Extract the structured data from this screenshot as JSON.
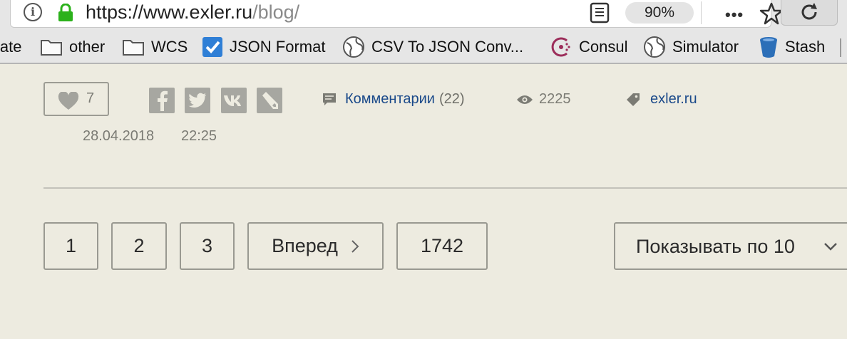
{
  "browser": {
    "url_host": "https://www.exler.ru",
    "url_path": "/blog/",
    "zoom": "90%",
    "bookmarks": [
      {
        "label": "late",
        "icon": "none"
      },
      {
        "label": "other",
        "icon": "folder-icon"
      },
      {
        "label": "WCS",
        "icon": "folder-icon"
      },
      {
        "label": "JSON Format",
        "icon": "checkbox-icon"
      },
      {
        "label": "CSV To JSON Conv...",
        "icon": "globe-icon"
      },
      {
        "label": "Consul",
        "icon": "consul-icon"
      },
      {
        "label": "Simulator",
        "icon": "globe-icon"
      },
      {
        "label": "Stash",
        "icon": "bucket-icon"
      }
    ]
  },
  "post_meta": {
    "likes": "7",
    "comments_label": "Комментарии",
    "comments_count": "(22)",
    "views": "2225",
    "tag": "exler.ru",
    "date": "28.04.2018",
    "time": "22:25"
  },
  "share_icons": [
    "facebook-icon",
    "twitter-icon",
    "vk-icon",
    "livejournal-icon"
  ],
  "pagination": {
    "pages": [
      "1",
      "2",
      "3"
    ],
    "next_label": "Вперед",
    "last_page": "1742",
    "per_page_label": "Показывать по 10"
  }
}
